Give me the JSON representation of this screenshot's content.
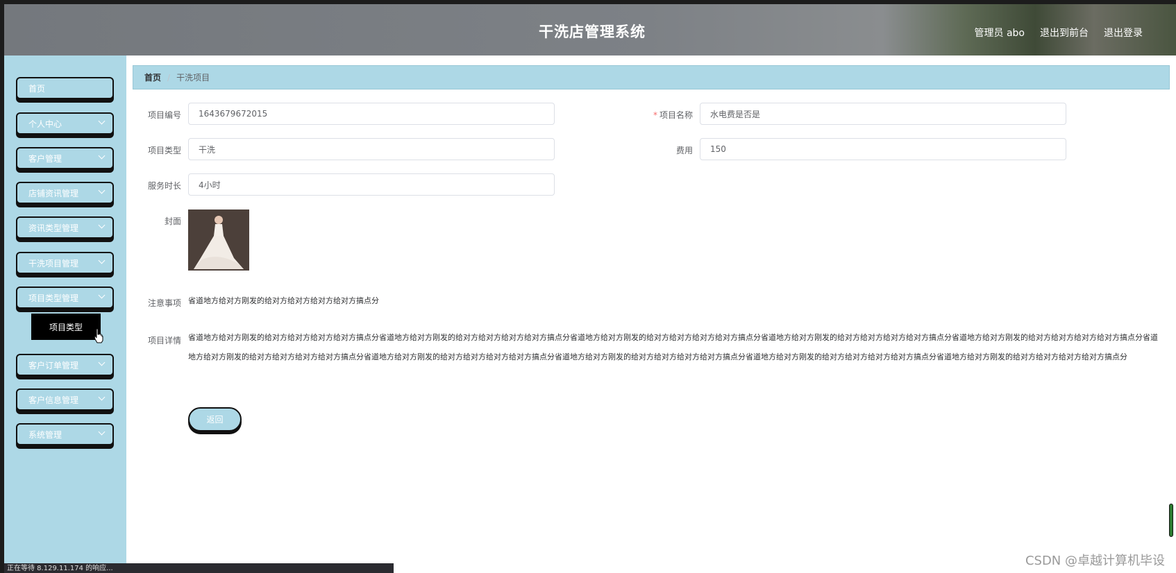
{
  "header": {
    "title": "干洗店管理系统",
    "user_label": "管理员 abo",
    "front_label": "退出到前台",
    "logout_label": "退出登录"
  },
  "sidebar": {
    "items": [
      {
        "label": "首页"
      },
      {
        "label": "个人中心"
      },
      {
        "label": "客户管理"
      },
      {
        "label": "店铺资讯管理"
      },
      {
        "label": "资讯类型管理"
      },
      {
        "label": "干洗项目管理"
      },
      {
        "label": "项目类型管理"
      },
      {
        "label": "客户订单管理"
      },
      {
        "label": "客户信息管理"
      },
      {
        "label": "系统管理"
      }
    ],
    "popup_label": "项目类型"
  },
  "breadcrumb": {
    "home": "首页",
    "current": "干洗项目"
  },
  "form": {
    "code_label": "项目编号",
    "code_value": "1643679672015",
    "name_label": "项目名称",
    "name_value": "水电费是否是",
    "type_label": "项目类型",
    "type_value": "干洗",
    "fee_label": "费用",
    "fee_value": "150",
    "duration_label": "服务时长",
    "duration_value": "4小时",
    "cover_label": "封面",
    "notes_label": "注意事项",
    "notes_value": "省道地方给对方刚发的给对方给对方给对方给对方搞点分",
    "details_label": "项目详情",
    "details_value": "省道地方给对方刚发的给对方给对方给对方给对方搞点分省道地方给对方刚发的给对方给对方给对方给对方搞点分省道地方给对方刚发的给对方给对方给对方给对方搞点分省道地方给对方刚发的给对方给对方给对方给对方搞点分省道地方给对方刚发的给对方给对方给对方给对方搞点分省道地方给对方刚发的给对方给对方给对方给对方搞点分省道地方给对方刚发的给对方给对方给对方给对方搞点分省道地方给对方刚发的给对方给对方给对方给对方搞点分省道地方给对方刚发的给对方给对方给对方给对方搞点分省道地方给对方刚发的给对方给对方给对方给对方搞点分",
    "back_label": "返回"
  },
  "status_text": "正在等待 8.129.11.174 的响应...",
  "watermark": "CSDN @卓越计算机毕设"
}
